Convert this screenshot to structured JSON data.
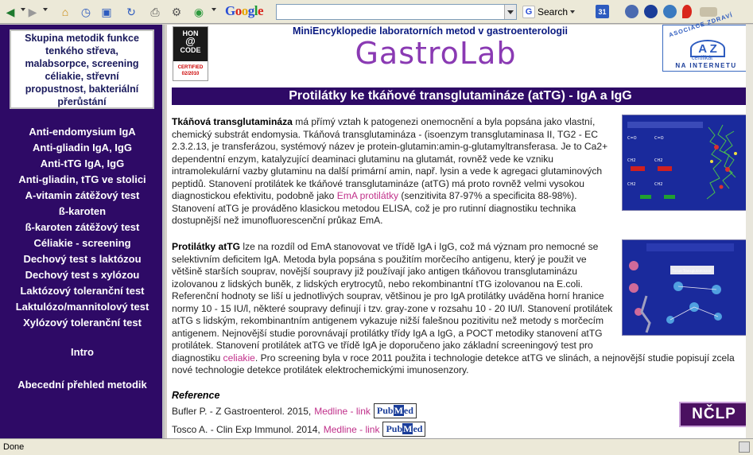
{
  "toolbar": {
    "icons": [
      "back-icon",
      "forward-icon",
      "home-icon",
      "history-icon",
      "bookmark-icon",
      "reload-icon",
      "print-icon",
      "tools-icon",
      "web-icon"
    ],
    "google_logo": "Google",
    "search_value": "",
    "search_label": "Search",
    "calendar_label": "31"
  },
  "sidebar": {
    "box_lines": [
      "Skupina metodik funkce",
      "tenkého střeva,",
      "malabsorpce, screening",
      "céliakie, střevní",
      "propustnost, bakteriální",
      "přerůstání"
    ],
    "items": [
      {
        "label": "Anti-endomysium IgA"
      },
      {
        "label": "Anti-gliadin IgA, IgG"
      },
      {
        "label": "Anti-tTG IgA, IgG"
      },
      {
        "label": "Anti-gliadin, tTG ve stolici"
      },
      {
        "label": "A-vitamin zátěžový test"
      },
      {
        "label": "ß-karoten"
      },
      {
        "label": "ß-karoten zátěžový test"
      },
      {
        "label": "Céliakie - screening"
      },
      {
        "label": "Dechový test s laktózou"
      },
      {
        "label": "Dechový test s xylózou"
      },
      {
        "label": "Laktózový toleranční test"
      },
      {
        "label": "Laktulózo/mannitolový test"
      },
      {
        "label": "Xylózový toleranční test"
      }
    ],
    "intro": "Intro",
    "abc": "Abecední přehled metodik"
  },
  "header": {
    "hon_line1": "HON",
    "hon_at": "@",
    "hon_line2": "CODE",
    "hon_certified": "CERTIFIED",
    "hon_date": "02/2010",
    "subtitle": "MiniEncyklopedie laboratorních metod v gastroenterologii",
    "logo": "GastroLab",
    "azk_top": "ASOCIACE ZDRAVÍ",
    "azk_mark": "A Z",
    "azk_cert": "certifikát",
    "azk_bottom": "NA INTERNETU"
  },
  "article": {
    "title": "Protilátky ke tkáňové transglutamináze (atTG) - IgA a IgG",
    "p1_lead": "Tkáňová transglutamináza",
    "p1_text": " má přímý vztah k patogenezi onemocnění a byla popsána jako vlastní, chemický substrát endomysia. Tkáňová transglutamináza - (isoenzym transglutaminasa II, TG2 - EC 2.3.2.13, je transferázou, systémový název je protein-glutamin:amin-g-glutamyltransferasa. Je to Ca2+ dependentní enzym, katalyzující deaminaci glutaminu na glutamát, rovněž vede ke vzniku intramolekulární vazby glutaminu na další primární amin, např. lysin a vede k agregaci glutaminových peptidů. Stanovení protilátek ke tkáňové transglutamináze (atTG) má proto rovněž velmi vysokou diagnostickou efektivitu, podobně jako ",
    "p1_link": "EmA protilátky",
    "p1_tail": " (senzitivita 87-97% a specificita 88-98%). Stanovení atTG je prováděno klasickou metodou ELISA, což je pro rutinní diagnostiku technika dostupnější než imunofluorescenční průkaz EmA.",
    "p2_lead": "Protilátky atTG",
    "p2_text": " lze na rozdíl od EmA stanovovat ve třídě IgA i IgG, což má význam pro nemocné se selektivním deficitem IgA. Metoda byla popsána s použitím morčecího antigenu, který je použit ve většině starších souprav, novější soupravy již používají jako antigen tkáňovou transglutaminázu izolovanou z lidských buněk, z lidských erytrocytů, nebo rekombinantní tTG izolovanou na E.coli. Referenční hodnoty se liší u jednotlivých souprav, většinou je pro IgA protilátky uváděna horní hranice normy 10 - 15 IU/l, některé soupravy definují i tzv. gray-zone v rozsahu 10 - 20 IU/l. Stanovení protilátek atTG s lidským, rekombinantním antigenem vykazuje nižší falešnou pozitivitu než metody s morčecím antigenem. Nejnovější studie porovnávají protilátky třídy IgA a IgG, a POCT metodiky stanovení atTG protilátek. Stanovení protilátek atTG ve třídě IgA je doporučeno jako základní screeningový test pro diagnostiku ",
    "p2_link": "celiakie",
    "p2_tail": ". Pro screening byla v roce 2011 použita i technologie detekce atTG ve slinách, a nejnovější studie popisují zcela nové technologie detekce protilátek elektrochemickými imunosenzory.",
    "ref_heading": "Reference",
    "refs": [
      {
        "text": "Bufler P. - Z Gastroenterol. 2015, ",
        "link": "Medline - link"
      },
      {
        "text": "Tosco A. - Clin Exp Immunol. 2014, ",
        "link": "Medline - link"
      }
    ],
    "pubmed_pub": "Pub",
    "pubmed_m": "M",
    "pubmed_ed": "ed",
    "nclp": "NČLP"
  },
  "status": {
    "text": "Done"
  },
  "colors": {
    "sidebar_bg": "#2e0a66",
    "title_bg": "#2e0a66",
    "logo": "#8a3ab3",
    "link": "#c0308a"
  }
}
